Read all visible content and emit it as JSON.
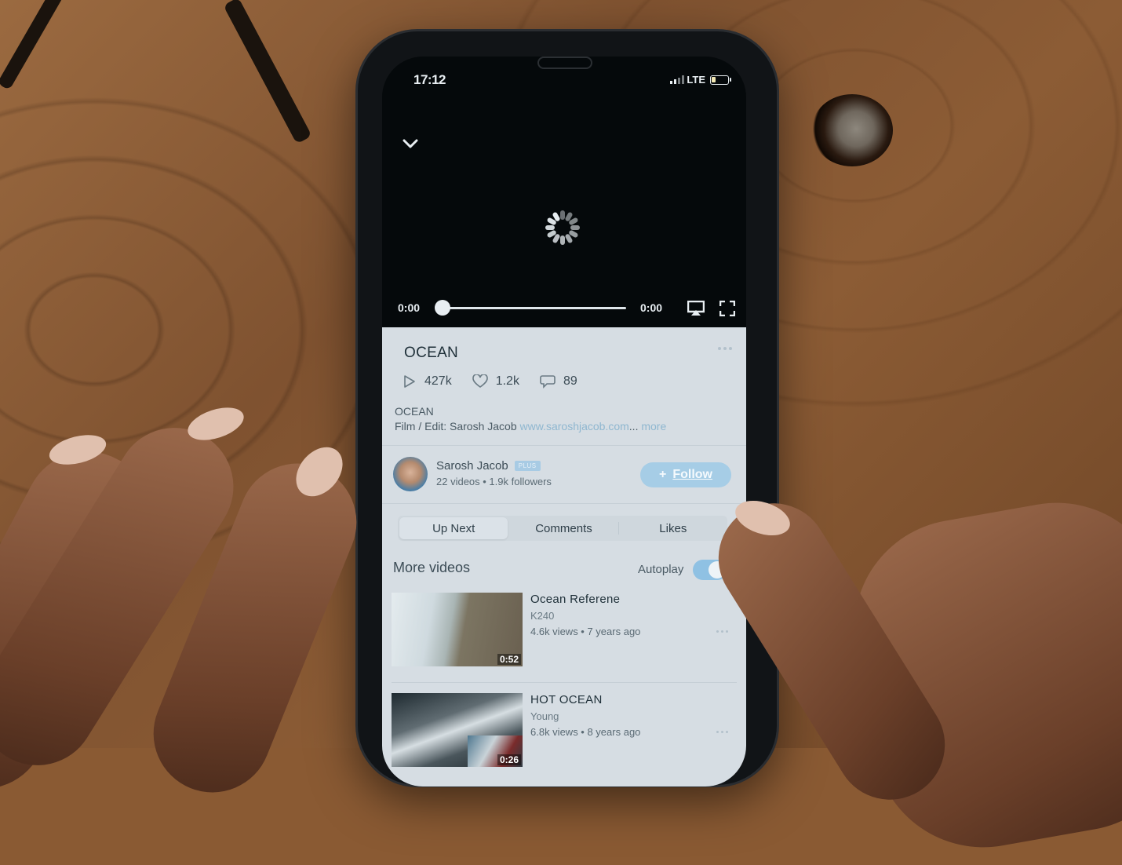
{
  "status_bar": {
    "time": "17:12",
    "network": "LTE",
    "battery_level": 0.2
  },
  "player": {
    "current_time": "0:00",
    "duration": "0:00",
    "progress": 0,
    "state": "loading"
  },
  "video": {
    "title": "OCEAN",
    "plays": "427k",
    "likes": "1.2k",
    "comments": "89",
    "description_line1": "OCEAN",
    "description_prefix": "Film / Edit: Sarosh Jacob",
    "description_link": "www.saroshjacob.com",
    "description_ellipsis": "...",
    "more_label": "more"
  },
  "author": {
    "name": "Sarosh Jacob",
    "badge": "PLUS",
    "stats": "22 videos • 1.9k followers",
    "follow_label": "Follow",
    "follow_icon": "+"
  },
  "tabs": [
    {
      "label": "Up Next",
      "active": true
    },
    {
      "label": "Comments",
      "active": false
    },
    {
      "label": "Likes",
      "active": false
    }
  ],
  "section": {
    "title": "More videos",
    "autoplay_label": "Autoplay",
    "autoplay_on": true
  },
  "videos": [
    {
      "title": "Ocean Referene",
      "channel": "K240",
      "meta": "4.6k views • 7 years ago",
      "duration": "0:52"
    },
    {
      "title": "HOT OCEAN",
      "channel": "Young",
      "meta": "6.8k views • 8 years ago",
      "duration": "0:26"
    }
  ],
  "colors": {
    "accent": "#a6cde6",
    "link": "#8fb7d0",
    "sheet": "#d6dde3",
    "player_bg": "#05090b"
  }
}
